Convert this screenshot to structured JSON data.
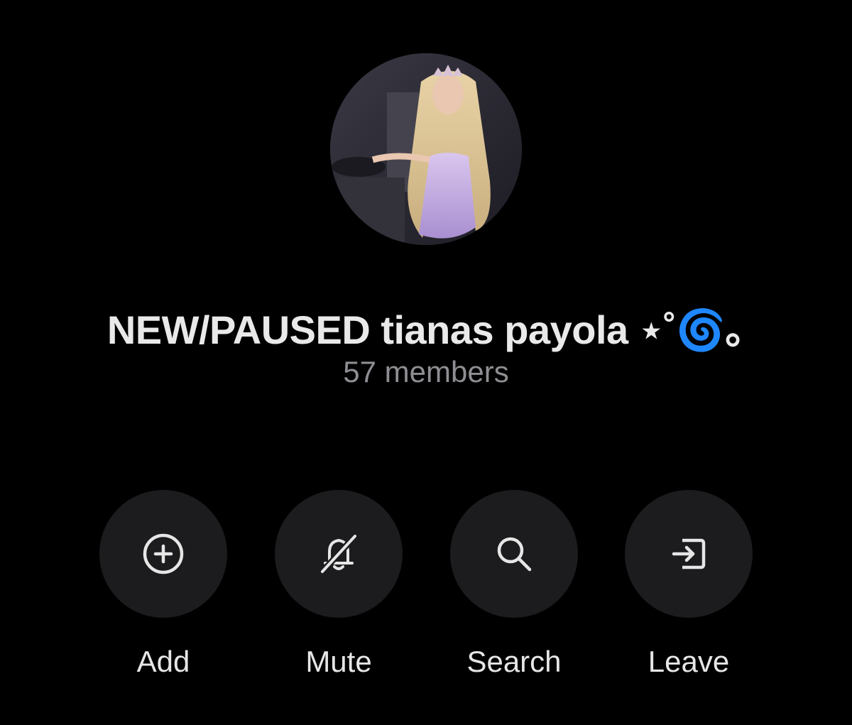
{
  "group": {
    "name": "NEW/PAUSED tianas payola ⋆˚🌀｡",
    "members": "57 members",
    "avatar_icon": "group-avatar-photo"
  },
  "actions": [
    {
      "label": "Add",
      "icon": "add-circle-icon"
    },
    {
      "label": "Mute",
      "icon": "bell-slash-icon"
    },
    {
      "label": "Search",
      "icon": "search-icon"
    },
    {
      "label": "Leave",
      "icon": "leave-icon"
    }
  ],
  "colors": {
    "background": "#000000",
    "button_bg": "#1c1c1e",
    "text_primary": "#e9e9e9",
    "text_secondary": "#8e8e93"
  }
}
